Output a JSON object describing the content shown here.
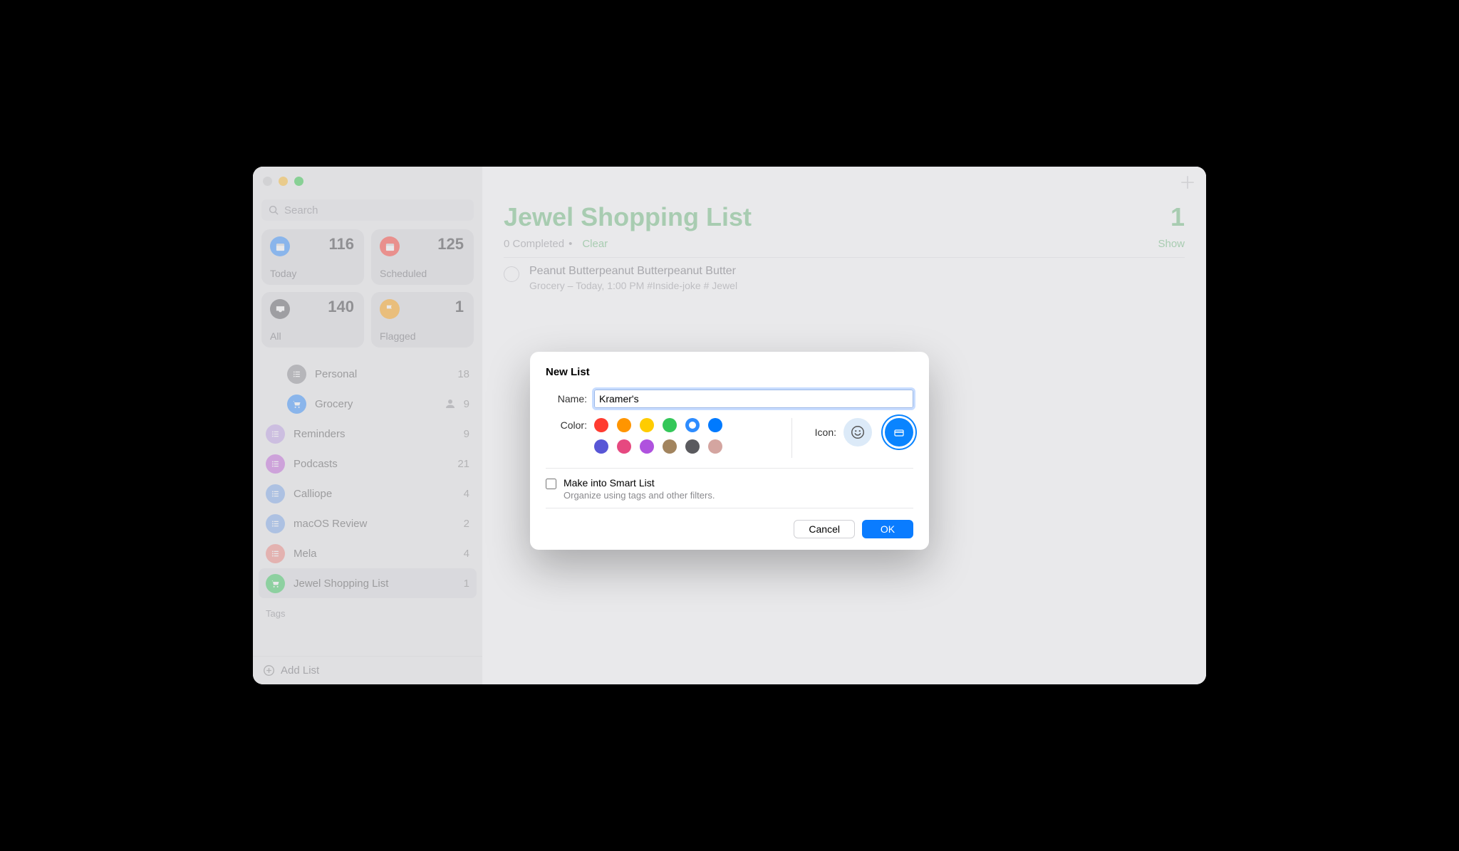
{
  "search": {
    "placeholder": "Search"
  },
  "cards": [
    {
      "label": "Today",
      "count": "116",
      "color": "#2d8cff",
      "icon": "calendar"
    },
    {
      "label": "Scheduled",
      "count": "125",
      "color": "#ff3b30",
      "icon": "calendar"
    },
    {
      "label": "All",
      "count": "140",
      "color": "#5a5a5e",
      "icon": "tray"
    },
    {
      "label": "Flagged",
      "count": "1",
      "color": "#ff9f0a",
      "icon": "flag"
    }
  ],
  "lists": [
    {
      "name": "Personal",
      "count": "18",
      "color": "#8e8e93",
      "indent": true
    },
    {
      "name": "Grocery",
      "count": "9",
      "color": "#2d8cff",
      "indent": true,
      "shared": true,
      "icon": "cart"
    },
    {
      "name": "Reminders",
      "count": "9",
      "color": "#bf9fe6"
    },
    {
      "name": "Podcasts",
      "count": "21",
      "color": "#c263d9"
    },
    {
      "name": "Calliope",
      "count": "4",
      "color": "#7aa7ea"
    },
    {
      "name": "macOS Review",
      "count": "2",
      "color": "#7aa7ea"
    },
    {
      "name": "Mela",
      "count": "4",
      "color": "#f2857d"
    },
    {
      "name": "Jewel Shopping List",
      "count": "1",
      "color": "#34c759",
      "selected": true,
      "icon": "cart"
    }
  ],
  "tags_header": "Tags",
  "footer": {
    "add_list": "Add List"
  },
  "main": {
    "title": "Jewel Shopping List",
    "count": "1",
    "completed": "0 Completed",
    "dot": "•",
    "clear": "Clear",
    "show": "Show",
    "item": {
      "title": "Peanut Butterpeanut Butterpeanut Butter",
      "meta": "Grocery – Today, 1:00 PM  #Inside-joke # Jewel"
    }
  },
  "modal": {
    "title": "New List",
    "name_label": "Name:",
    "name_value": "Kramer's",
    "color_label": "Color:",
    "icon_label": "Icon:",
    "colors_row1": [
      "#ff3b30",
      "#ff9500",
      "#ffcc00",
      "#34c759",
      "#2d8cff",
      "#007aff"
    ],
    "colors_row2": [
      "#5856d6",
      "#e64980",
      "#af52de",
      "#a2845e",
      "#5a5a5e",
      "#d4a5a0"
    ],
    "selected_color_index": 4,
    "smart_title": "Make into Smart List",
    "smart_desc": "Organize using tags and other filters.",
    "cancel": "Cancel",
    "ok": "OK"
  }
}
